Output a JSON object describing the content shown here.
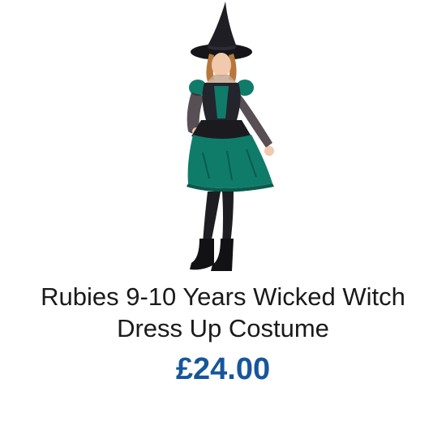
{
  "product": {
    "image_subject": "child-witch-costume-photo",
    "title_line1": "Rubies 9-10 Years Wicked Witch",
    "title_line2": "Dress Up Costume",
    "price": "£24.00"
  },
  "colors": {
    "price": "#17569b",
    "title": "#1a1a1a",
    "costume_green": "#0f7c6a",
    "costume_black": "#1b1b1f"
  }
}
